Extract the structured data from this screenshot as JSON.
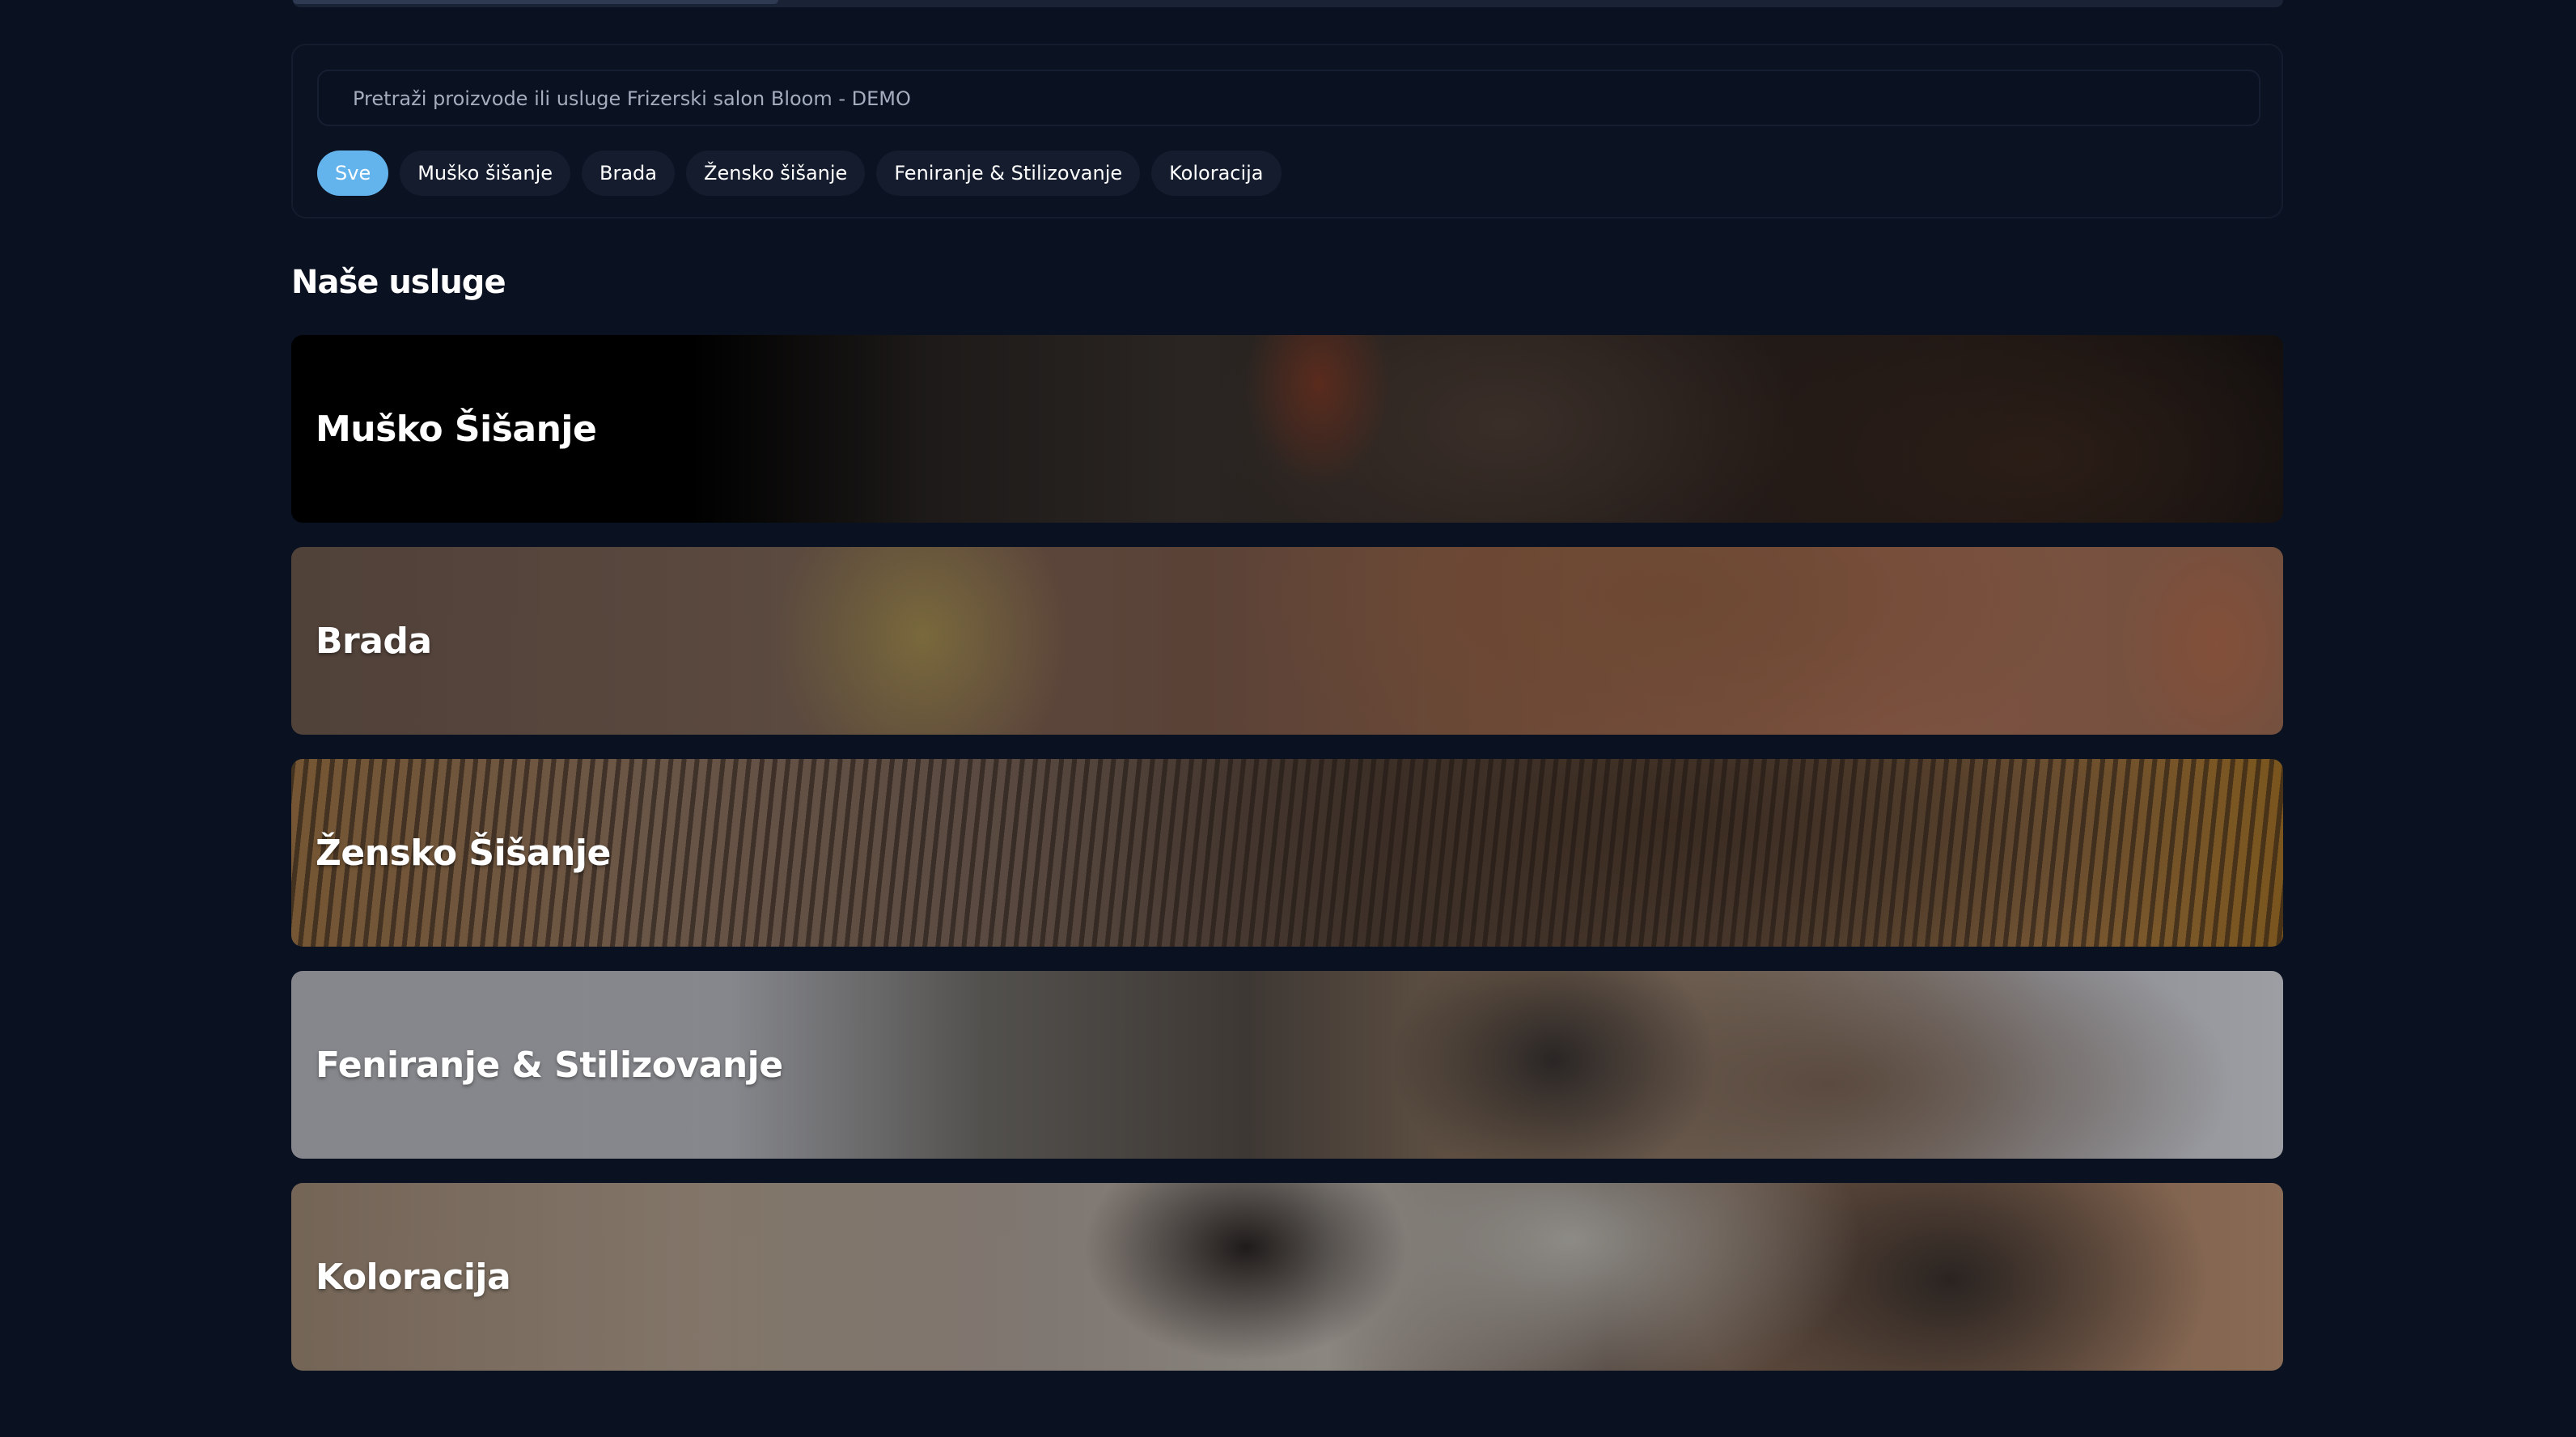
{
  "header": {
    "top_strip": "",
    "top_strip_progress": 0.12
  },
  "search": {
    "placeholder": "Pretraži proizvode ili usluge Frizerski salon Bloom - DEMO",
    "value": ""
  },
  "filters": {
    "selected": "Sve",
    "items": [
      {
        "label": "Sve",
        "active": true
      },
      {
        "label": "Muško šišanje",
        "active": false
      },
      {
        "label": "Brada",
        "active": false
      },
      {
        "label": "Žensko šišanje",
        "active": false
      },
      {
        "label": "Feniranje & Stilizovanje",
        "active": false
      },
      {
        "label": "Koloracija",
        "active": false
      }
    ]
  },
  "services": {
    "title": "Naše usluge",
    "cards": [
      {
        "label": "Muško Šišanje"
      },
      {
        "label": "Brada"
      },
      {
        "label": "Žensko Šišanje"
      },
      {
        "label": "Feniranje & Stilizovanje"
      },
      {
        "label": "Koloracija"
      }
    ]
  },
  "colors": {
    "background": "#0a1120",
    "accent": "#63b3ed",
    "chip": "#141c2e"
  }
}
